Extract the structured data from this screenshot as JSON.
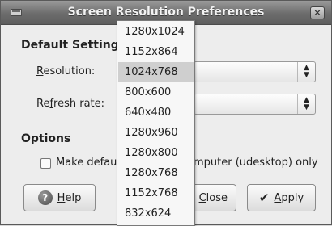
{
  "window": {
    "title": "Screen Resolution Preferences",
    "close_glyph": "×"
  },
  "sections": {
    "default_settings": "Default Settings",
    "options": "Options"
  },
  "fields": {
    "resolution_label_mnemonic": "R",
    "resolution_label_rest": "esolution:",
    "refresh_label_prefix": "Re",
    "refresh_label_mnemonic": "f",
    "refresh_label_rest": "resh rate:"
  },
  "option": {
    "checkbox_checked": false,
    "label_prefix": "Make defau",
    "label_mnemonic": "l",
    "label_visible_tail": "mputer (udesktop) only"
  },
  "buttons": {
    "help_mnemonic": "H",
    "help_rest": "elp",
    "close_mnemonic": "C",
    "close_rest": "lose",
    "apply_mnemonic": "A",
    "apply_rest": "pply"
  },
  "resolution_menu": {
    "selected": "1024x768",
    "options": [
      "1280x1024",
      "1152x864",
      "1024x768",
      "800x600",
      "640x480",
      "1280x960",
      "1280x800",
      "1280x768",
      "1152x768",
      "832x624"
    ]
  },
  "icons": {
    "window_menu": "window-menu-icon",
    "close": "close-icon",
    "help": "help-icon",
    "apply": "checkmark-icon",
    "combo_arrows": "updown-arrows-icon"
  }
}
